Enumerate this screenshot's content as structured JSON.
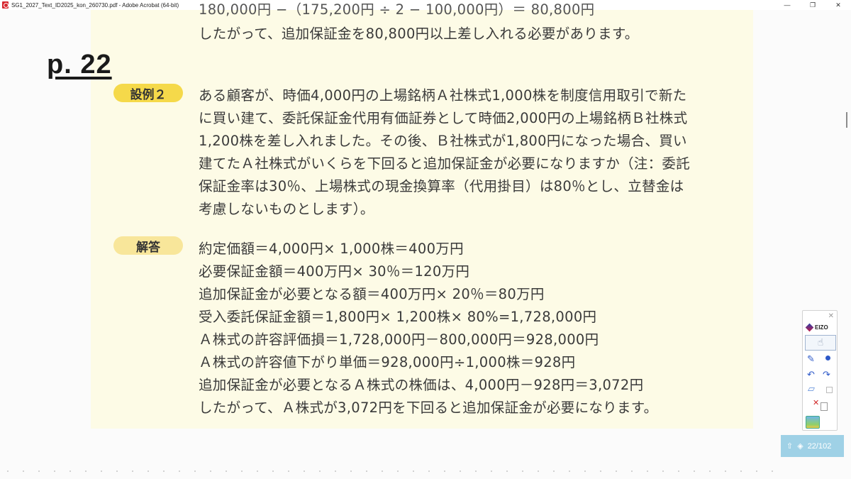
{
  "window": {
    "title": "SG1_2027_Text_ID2025_kon_260730.pdf - Adobe Acrobat (64-bit)",
    "controls": {
      "minimize": "—",
      "restore": "❐",
      "close": "✕"
    }
  },
  "page": {
    "top_partial_line": "180,000円 −（175,200円 ÷ 2 − 100,000円）＝ 80,800円",
    "intro_line": "したがって、追加保証金を80,800円以上差し入れる必要があります。",
    "page_label": "p. 22",
    "question_badge": "設例２",
    "question_lines": [
      "ある顧客が、時価4,000円の上場銘柄Ａ社株式1,000株を制度信用取引で新た",
      "に買い建て、委託保証金代用有価証券として時価2,000円の上場銘柄Ｂ社株式",
      "1,200株を差し入れました。その後、Ｂ社株式が1,800円になった場合、買い",
      "建てたＡ社株式がいくらを下回ると追加保証金が必要になりますか（注：委託",
      "保証金率は30％、上場株式の現金換算率（代用掛目）は80％とし、立替金は",
      "考慮しないものとします）。"
    ],
    "answer_badge": "解答",
    "answer_lines": [
      "約定価額＝4,000円× 1,000株＝400万円",
      "必要保証金額＝400万円× 30％＝120万円",
      "追加保証金が必要となる額＝400万円× 20％＝80万円",
      "受入委託保証金額＝1,800円× 1,200株× 80%=1,728,000円",
      "Ａ株式の許容評価損＝1,728,000円－800,000円＝928,000円",
      "Ａ株式の許容値下がり単価＝928,000円÷1,000株＝928円",
      "追加保証金が必要となるＡ株式の株価は、4,000円－928円＝3,072円",
      "したがって、Ａ株式が3,072円を下回ると追加保証金が必要になります。"
    ]
  },
  "tool_panel": {
    "brand": "EIZO",
    "close": "✕",
    "icons": [
      "eizo-logo-icon",
      "hand-pointer-icon",
      "pen-icon",
      "color-dot-icon",
      "undo-icon",
      "redo-icon",
      "eraser-icon",
      "shape-icon",
      "clear-icon",
      "document-icon",
      "app-thumbnail-icon"
    ]
  },
  "page_nav": {
    "indicator": "22/102"
  },
  "colors": {
    "page_background": "#fdfbe6",
    "question_badge": "#f5d94a",
    "answer_badge": "#f8e69a",
    "nav_widget": "#9fd1e6"
  }
}
